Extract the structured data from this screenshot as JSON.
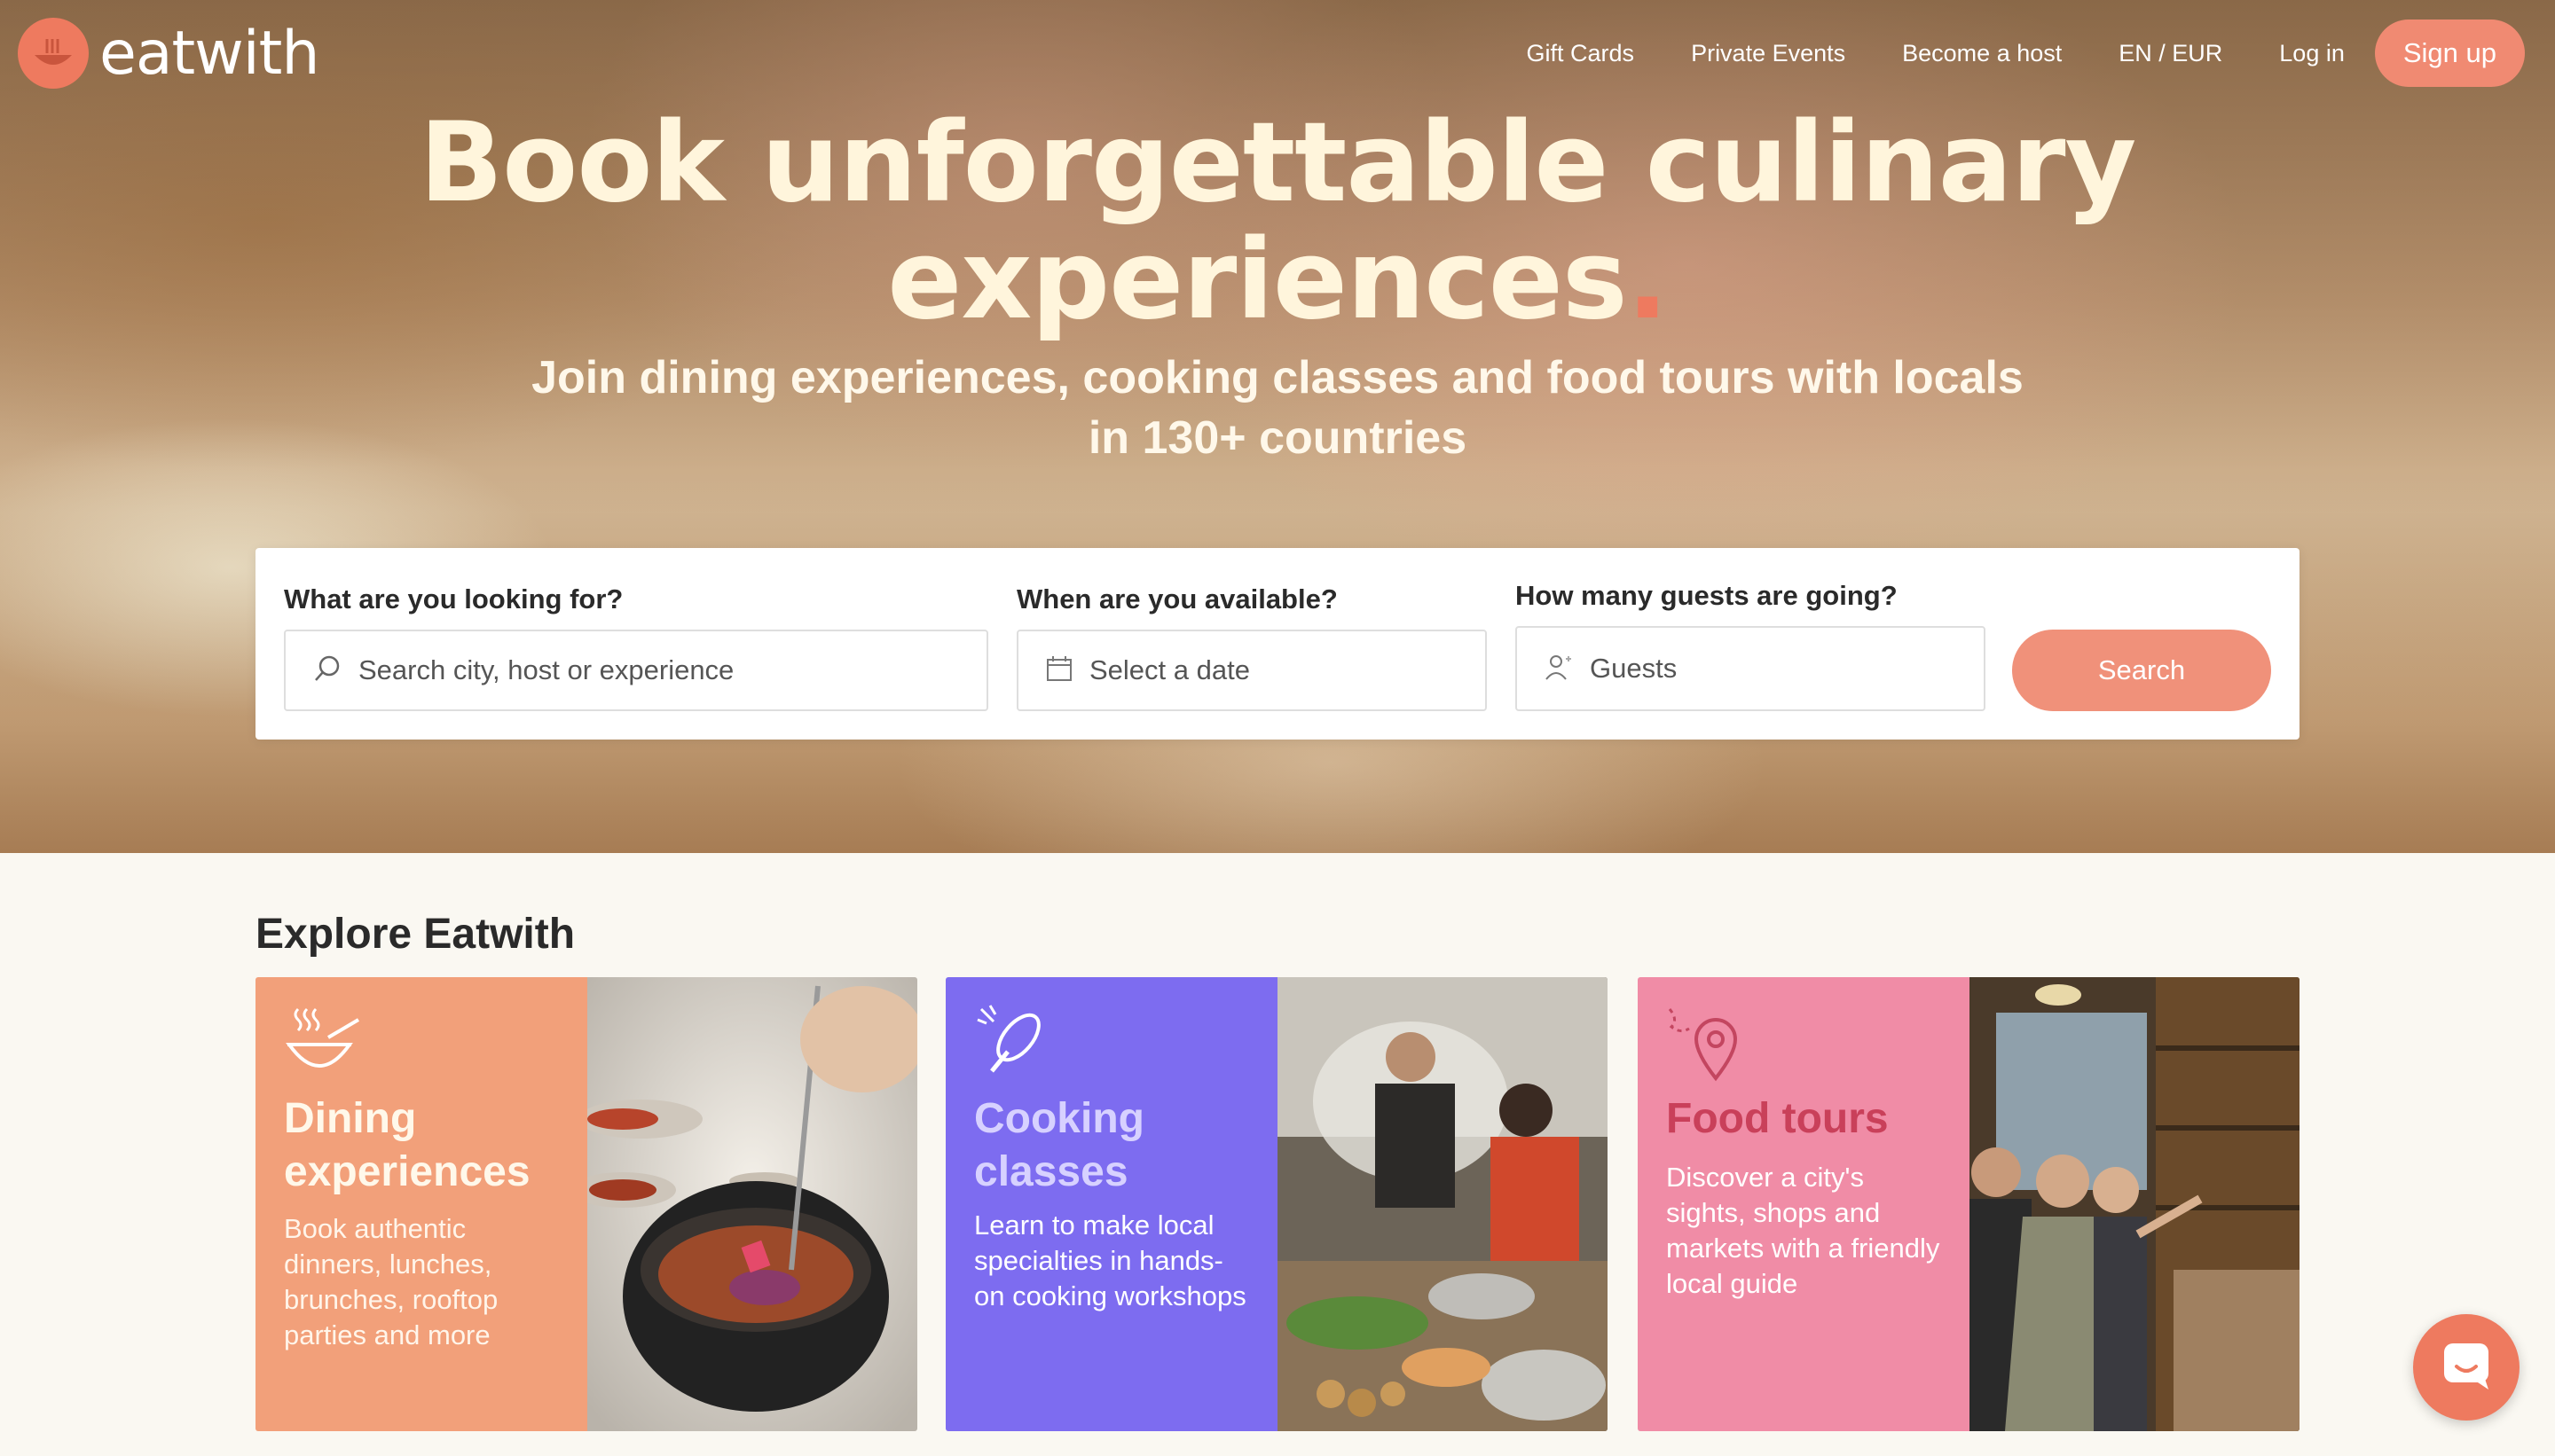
{
  "brand": {
    "name": "eatwith",
    "accent": "#ee7a5f"
  },
  "nav": {
    "gift_cards": "Gift Cards",
    "private_events": "Private Events",
    "become_host": "Become a host",
    "locale": "EN / EUR",
    "login": "Log in",
    "signup": "Sign up"
  },
  "hero": {
    "headline_line1": "Book unforgettable culinary",
    "headline_line2": "experiences",
    "headline_dot": ".",
    "subline_line1": "Join dining experiences, cooking classes and food tours with locals",
    "subline_line2": "in 130+ countries"
  },
  "search": {
    "what_label": "What are you looking for?",
    "what_placeholder": "Search city, host or experience",
    "when_label": "When are you available?",
    "when_placeholder": "Select a date",
    "guests_label": "How many guests are going?",
    "guests_placeholder": "Guests",
    "button": "Search"
  },
  "explore": {
    "title": "Explore Eatwith",
    "cards": [
      {
        "title": "Dining experiences",
        "desc": "Book authentic dinners, lunches, brunches, rooftop parties and more",
        "color": "#f2a07a",
        "icon": "soup-bowl-icon"
      },
      {
        "title": "Cooking classes",
        "desc": "Learn to make local specialties in hands-on cooking workshops",
        "color": "#7d6cf0",
        "icon": "whisk-icon"
      },
      {
        "title": "Food tours",
        "desc": "Discover a city's sights, shops and markets with a friendly local guide",
        "color": "#f08ca6",
        "icon": "location-pin-icon"
      }
    ]
  }
}
